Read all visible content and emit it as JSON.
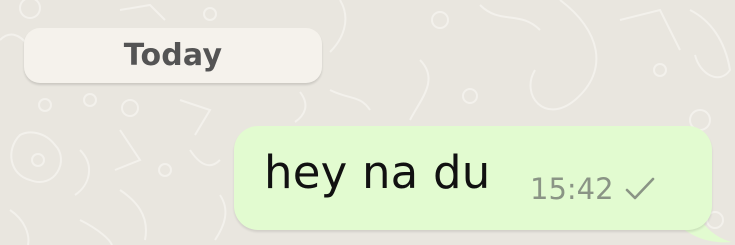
{
  "date_chip": {
    "label": "Today"
  },
  "message": {
    "text": "hey na du",
    "time": "15:42",
    "status_icon": "single-check-icon",
    "direction": "outgoing"
  },
  "colors": {
    "chat_background": "#e9e6df",
    "outgoing_bubble": "#e2fbd0",
    "date_chip": "#f5f2ec",
    "timestamp": "#8a9485"
  }
}
